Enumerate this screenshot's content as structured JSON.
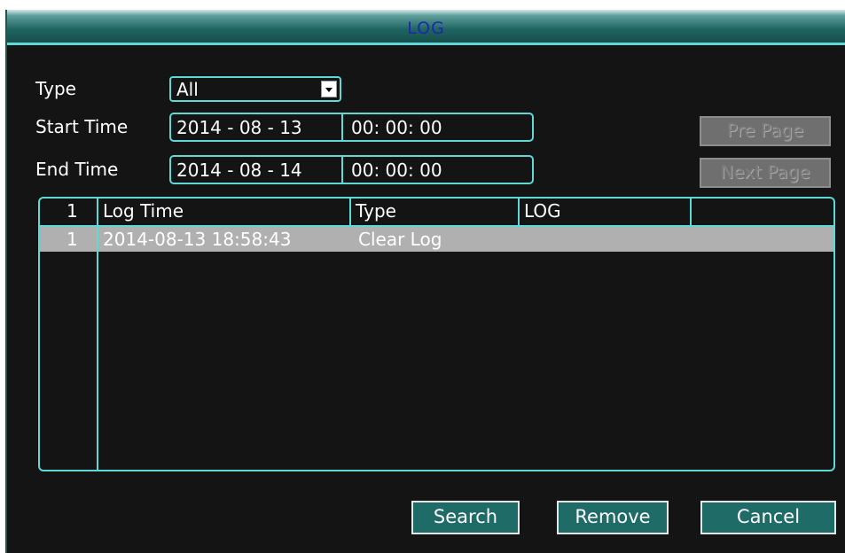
{
  "window": {
    "title": "LOG"
  },
  "filters": {
    "type_label": "Type",
    "type_value": "All",
    "start_label": "Start Time",
    "start_date": "2014 - 08 - 13",
    "start_time": "00: 00: 00",
    "end_label": "End Time",
    "end_date": "2014 - 08 - 14",
    "end_time": "00: 00: 00"
  },
  "paging": {
    "pre_page": "Pre Page",
    "next_page": "Next Page"
  },
  "table": {
    "headers": [
      "1",
      "Log Time",
      "Type",
      "LOG",
      ""
    ],
    "rows": [
      {
        "index": "1",
        "log_time": "2014-08-13 18:58:43",
        "type": "Clear Log",
        "log": ""
      }
    ]
  },
  "actions": {
    "search": "Search",
    "remove": "Remove",
    "cancel": "Cancel"
  },
  "colors": {
    "accent": "#5fd8d6",
    "title_text": "#1a2aa8",
    "button_bg": "#1f6b68",
    "selected_row": "#b0b0b0"
  }
}
